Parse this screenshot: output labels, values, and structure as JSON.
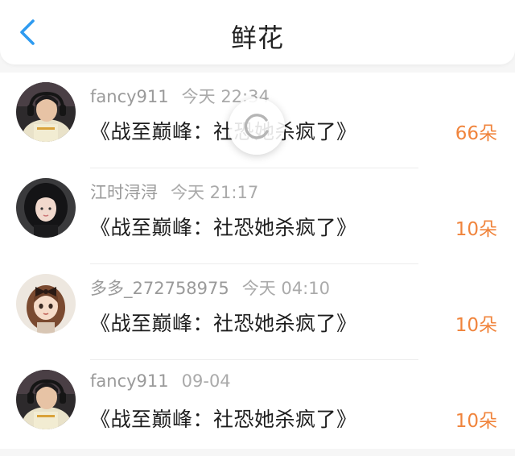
{
  "header": {
    "title": "鲜花",
    "back_icon": "chevron-left-icon",
    "accent_color": "#2f9bf0"
  },
  "records": [
    {
      "user": "fancy911",
      "time": "今天 22:34",
      "drama": "《战至巅峰：社恐她杀疯了》",
      "amount": "66朵",
      "avatar": "avatar-boy-with-headphones"
    },
    {
      "user": "江时浔浔",
      "time": "今天 21:17",
      "drama": "《战至巅峰：社恐她杀疯了》",
      "amount": "10朵",
      "avatar": "avatar-girl-dark-hair"
    },
    {
      "user": "多多_272758975",
      "time": "今天 04:10",
      "drama": "《战至巅峰：社恐她杀疯了》",
      "amount": "10朵",
      "avatar": "avatar-cartoon-girl-bow"
    },
    {
      "user": "fancy911",
      "time": "09-04",
      "drama": "《战至巅峰：社恐她杀疯了》",
      "amount": "10朵",
      "avatar": "avatar-boy-with-headphones"
    }
  ],
  "loading_icon": "loading-spinner-icon",
  "amount_color": "#f0843c"
}
